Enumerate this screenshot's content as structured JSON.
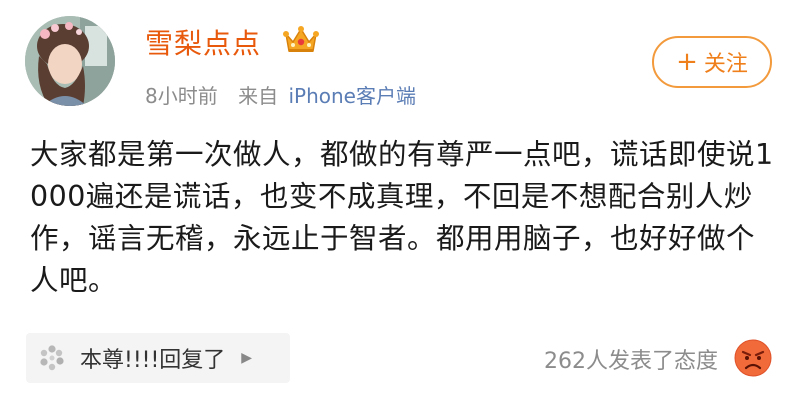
{
  "post": {
    "username": "雪梨点点",
    "time": "8小时前",
    "source_label": "来自",
    "client": "iPhone客户端",
    "follow_label": "关注",
    "follow_plus": "+",
    "content": "大家都是第一次做人，都做的有尊严一点吧，谎话即使说1000遍还是谎话，也变不成真理，不回是不想配合别人炒作，谣言无稽，永远止于智者。都用用脑子，也好好做个人吧。",
    "reply_chip": "本尊!!!!回复了",
    "reactions": "262人发表了态度"
  },
  "icons": {
    "badge": "crown-icon",
    "chip": "pinwheel-icon",
    "reaction": "angry-face-icon",
    "chevron": "chevron-right-icon"
  },
  "colors": {
    "username": "#e8590c",
    "follow": "#ef7f1a",
    "client": "#5b7db5",
    "meta": "#8c8c8c"
  }
}
